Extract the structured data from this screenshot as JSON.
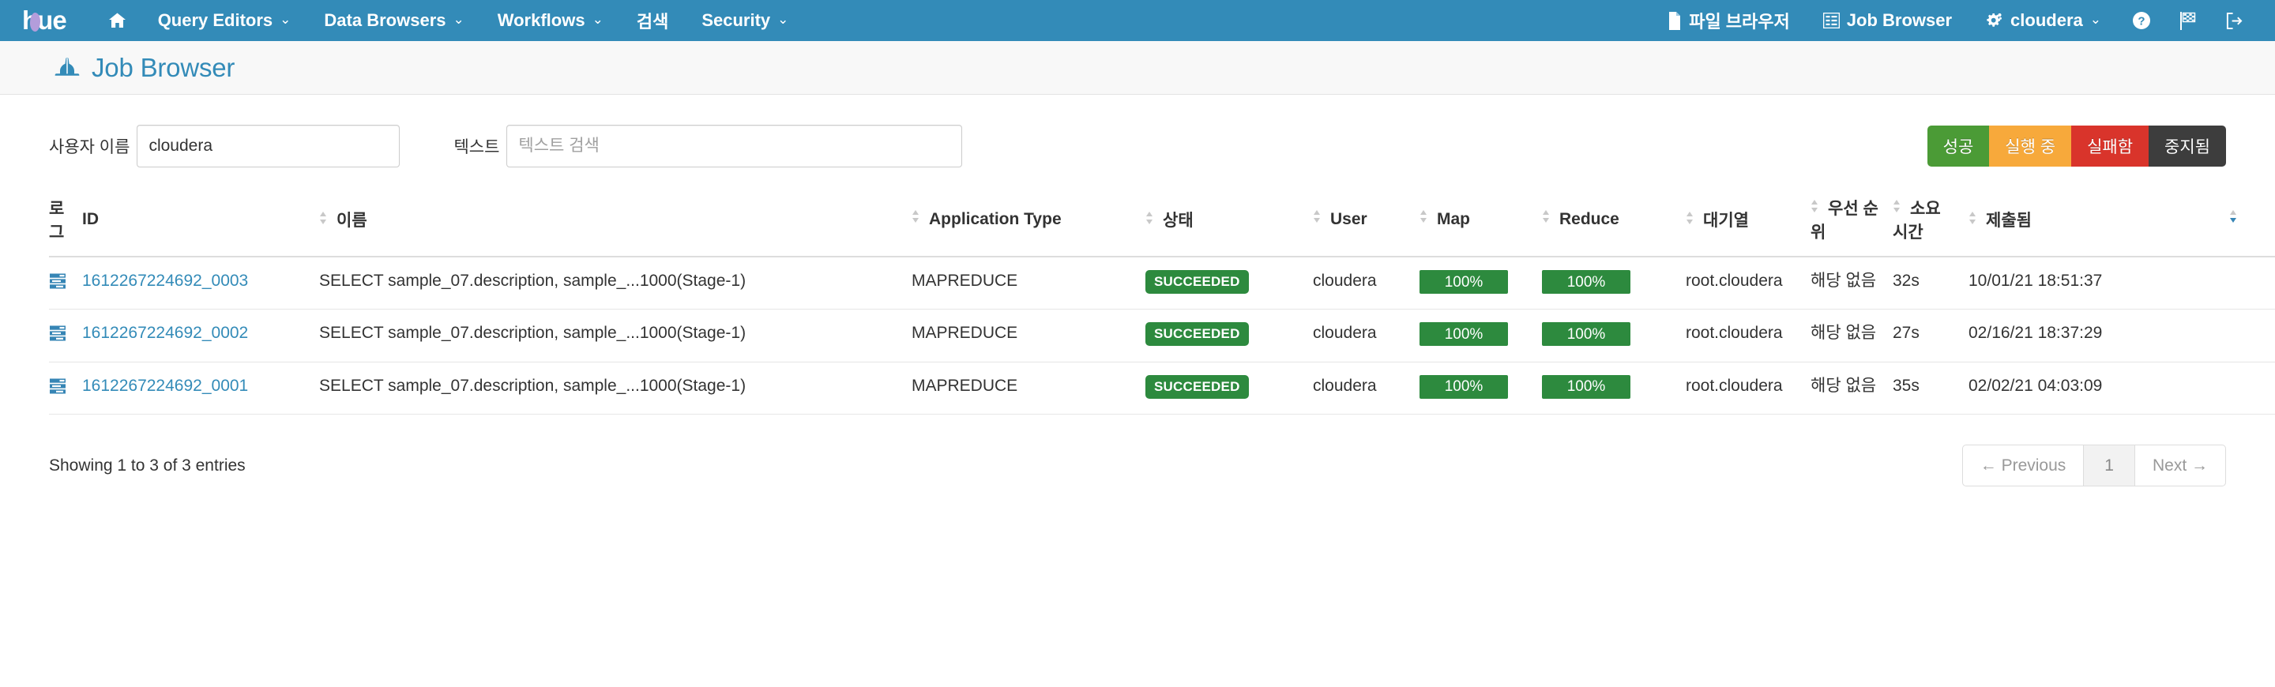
{
  "navbar": {
    "logo_text": "hue",
    "items": [
      {
        "label": "",
        "icon": "home-icon",
        "has_caret": false
      },
      {
        "label": "Query Editors",
        "icon": "",
        "has_caret": true
      },
      {
        "label": "Data Browsers",
        "icon": "",
        "has_caret": true
      },
      {
        "label": "Workflows",
        "icon": "",
        "has_caret": true
      },
      {
        "label": "검색",
        "icon": "",
        "has_caret": false
      },
      {
        "label": "Security",
        "icon": "",
        "has_caret": true
      }
    ],
    "right_items": [
      {
        "label": "파일 브라우저",
        "icon": "file-icon",
        "has_caret": false
      },
      {
        "label": "Job Browser",
        "icon": "list-icon",
        "has_caret": false
      },
      {
        "label": "cloudera",
        "icon": "cog-icon",
        "has_caret": true
      }
    ],
    "right_icons": [
      {
        "name": "help-icon"
      },
      {
        "name": "flag-icon"
      },
      {
        "name": "logout-icon"
      }
    ],
    "bg_color": "#338bb8"
  },
  "page": {
    "title": "Job Browser",
    "title_color": "#338bb8"
  },
  "filters": {
    "user_label": "사용자 이름",
    "user_value": "cloudera",
    "text_label": "텍스트",
    "text_value": "",
    "text_placeholder": "텍스트 검색",
    "status_buttons": [
      {
        "label": "성공",
        "color": "#4b9b36"
      },
      {
        "label": "실행 중",
        "color": "#f7a93b"
      },
      {
        "label": "실패함",
        "color": "#d9342b"
      },
      {
        "label": "중지됨",
        "color": "#3d3d3d"
      }
    ]
  },
  "table": {
    "headers": [
      {
        "label": "로그",
        "sortable": false
      },
      {
        "label": "ID",
        "sortable": false
      },
      {
        "label": "이름",
        "sortable": true
      },
      {
        "label": "Application Type",
        "sortable": true
      },
      {
        "label": "상태",
        "sortable": true
      },
      {
        "label": "User",
        "sortable": true
      },
      {
        "label": "Map",
        "sortable": true
      },
      {
        "label": "Reduce",
        "sortable": true
      },
      {
        "label": "대기열",
        "sortable": true
      },
      {
        "label": "우선 순위",
        "sortable": true
      },
      {
        "label": "소요 시간",
        "sortable": true
      },
      {
        "label": "제출됨",
        "sortable": true
      },
      {
        "label": "",
        "sortable": true,
        "sort_active": "desc"
      }
    ],
    "rows": [
      {
        "log_icon": "job-log-icon",
        "id": "1612267224692_0003",
        "name": "SELECT sample_07.description, sample_...1000(Stage-1)",
        "app_type": "MAPREDUCE",
        "status": "SUCCEEDED",
        "user": "cloudera",
        "map": "100%",
        "reduce": "100%",
        "queue": "root.cloudera",
        "priority": "해당 없음",
        "duration": "32s",
        "submitted": "10/01/21 18:51:37"
      },
      {
        "log_icon": "job-log-icon",
        "id": "1612267224692_0002",
        "name": "SELECT sample_07.description, sample_...1000(Stage-1)",
        "app_type": "MAPREDUCE",
        "status": "SUCCEEDED",
        "user": "cloudera",
        "map": "100%",
        "reduce": "100%",
        "queue": "root.cloudera",
        "priority": "해당 없음",
        "duration": "27s",
        "submitted": "02/16/21 18:37:29"
      },
      {
        "log_icon": "job-log-icon",
        "id": "1612267224692_0001",
        "name": "SELECT sample_07.description, sample_...1000(Stage-1)",
        "app_type": "MAPREDUCE",
        "status": "SUCCEEDED",
        "user": "cloudera",
        "map": "100%",
        "reduce": "100%",
        "queue": "root.cloudera",
        "priority": "해당 없음",
        "duration": "35s",
        "submitted": "02/02/21 04:03:09"
      }
    ]
  },
  "footer": {
    "info": "Showing 1 to 3 of 3 entries",
    "pagination": {
      "previous": "← Previous",
      "pages": [
        "1"
      ],
      "active_page": "1",
      "next": "Next →"
    }
  },
  "colors": {
    "accent": "#338bb8",
    "success": "#2d8a3e",
    "link": "#338bb8"
  }
}
